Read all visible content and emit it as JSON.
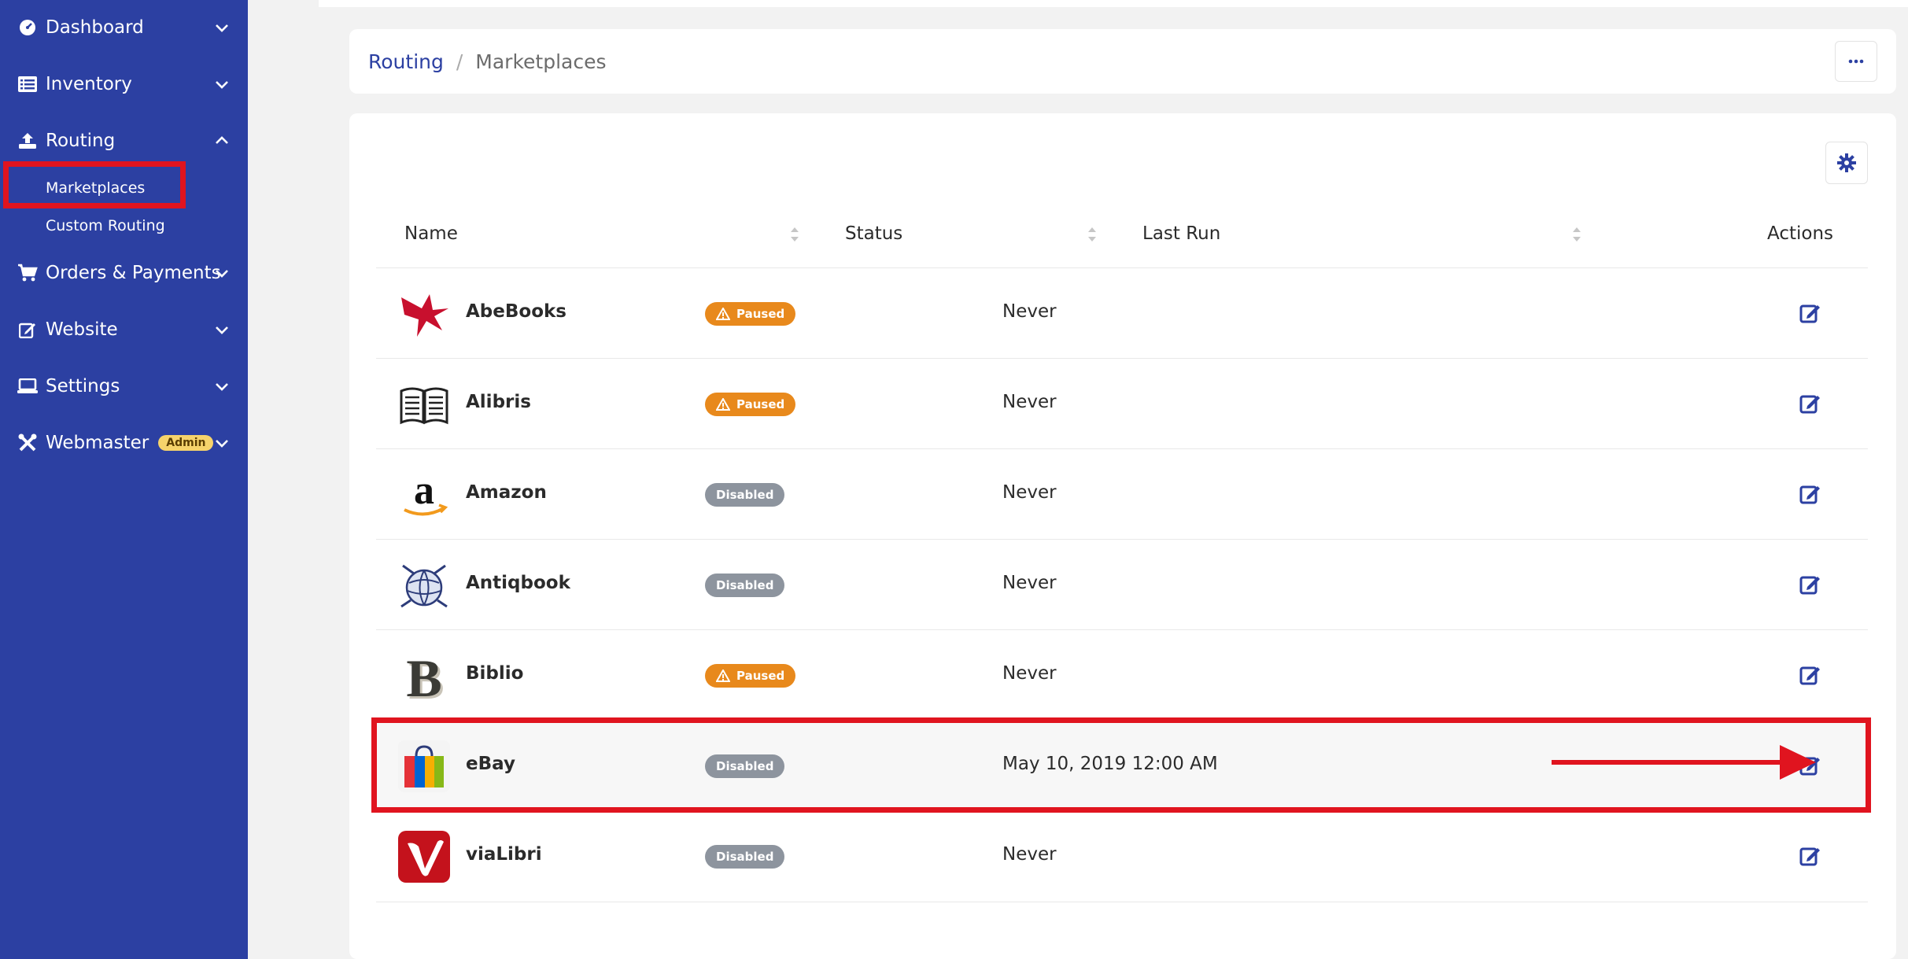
{
  "sidebar": {
    "items": [
      {
        "label": "Dashboard",
        "icon": "gauge-icon"
      },
      {
        "label": "Inventory",
        "icon": "list-icon"
      },
      {
        "label": "Routing",
        "icon": "upload-icon"
      },
      {
        "label": "Orders & Payments",
        "icon": "cart-icon"
      },
      {
        "label": "Website",
        "icon": "edit-icon"
      },
      {
        "label": "Settings",
        "icon": "laptop-icon"
      },
      {
        "label": "Webmaster",
        "icon": "tools-icon",
        "badge": "Admin"
      }
    ],
    "routing_subitems": [
      {
        "label": "Marketplaces",
        "active": true
      },
      {
        "label": "Custom Routing",
        "active": false
      }
    ]
  },
  "breadcrumb": {
    "parent": "Routing",
    "separator": "/",
    "current": "Marketplaces"
  },
  "table": {
    "headers": {
      "name": "Name",
      "status": "Status",
      "last_run": "Last Run",
      "actions": "Actions"
    },
    "rows": [
      {
        "name": "AbeBooks",
        "status": "Paused",
        "last_run": "Never",
        "logo": "abebooks-logo"
      },
      {
        "name": "Alibris",
        "status": "Paused",
        "last_run": "Never",
        "logo": "alibris-logo"
      },
      {
        "name": "Amazon",
        "status": "Disabled",
        "last_run": "Never",
        "logo": "amazon-logo"
      },
      {
        "name": "Antiqbook",
        "status": "Disabled",
        "last_run": "Never",
        "logo": "antiqbook-logo"
      },
      {
        "name": "Biblio",
        "status": "Paused",
        "last_run": "Never",
        "logo": "biblio-logo"
      },
      {
        "name": "eBay",
        "status": "Disabled",
        "last_run": "May 10, 2019 12:00 AM",
        "logo": "ebay-logo"
      },
      {
        "name": "viaLibri",
        "status": "Disabled",
        "last_run": "Never",
        "logo": "vialibri-logo"
      }
    ]
  },
  "colors": {
    "sidebar_bg": "#2c40a2",
    "paused": "#e8891c",
    "disabled": "#8d949e",
    "annotation_red": "#e0141f"
  }
}
